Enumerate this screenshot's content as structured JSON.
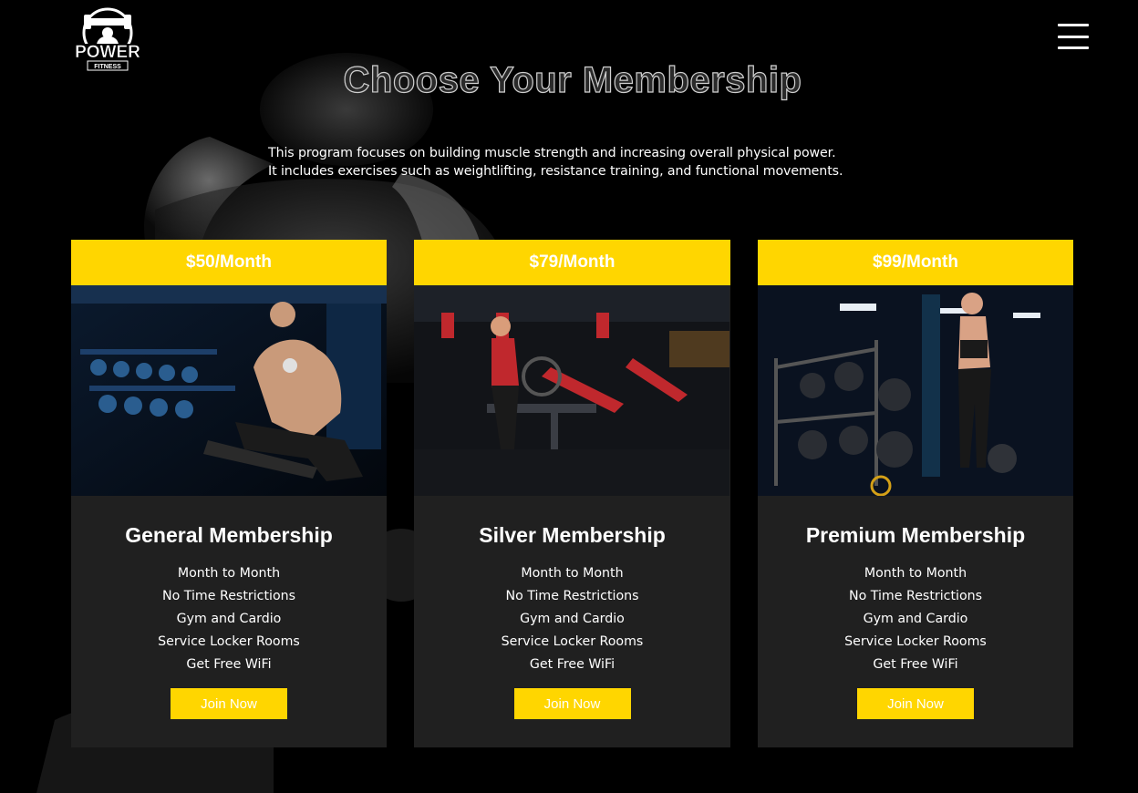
{
  "header": {
    "logo_text": "POWER",
    "logo_subtext": "FITNESS",
    "menu_icon": "hamburger-menu-icon"
  },
  "hero": {
    "title": "Choose Your Membership",
    "intro_line1": "This program focuses on building muscle strength and increasing overall physical power.",
    "intro_line2": "It includes exercises such as weightlifting, resistance training, and functional movements."
  },
  "plans": [
    {
      "price": "$50/Month",
      "name": "General Membership",
      "features": [
        "Month to Month",
        "No Time Restrictions",
        "Gym and Cardio",
        "Service Locker Rooms",
        "Get Free WiFi"
      ],
      "cta": "Join Now"
    },
    {
      "price": "$79/Month",
      "name": "Silver Membership",
      "features": [
        "Month to Month",
        "No Time Restrictions",
        "Gym and Cardio",
        "Service Locker Rooms",
        "Get Free WiFi"
      ],
      "cta": "Join Now"
    },
    {
      "price": "$99/Month",
      "name": "Premium Membership",
      "features": [
        "Month to Month",
        "No Time Restrictions",
        "Gym and Cardio",
        "Service Locker Rooms",
        "Get Free WiFi"
      ],
      "cta": "Join Now"
    }
  ],
  "colors": {
    "accent": "#ffd600",
    "background": "#000000",
    "card": "#202020"
  }
}
